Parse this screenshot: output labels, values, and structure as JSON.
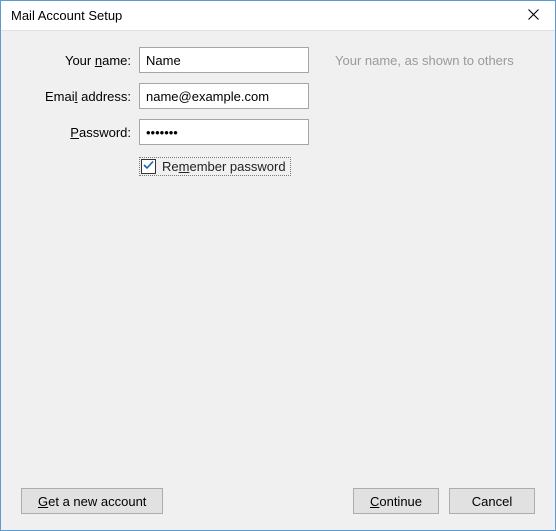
{
  "window": {
    "title": "Mail Account Setup"
  },
  "form": {
    "name_label_pre": "Your ",
    "name_label_ul": "n",
    "name_label_post": "ame:",
    "name_value": "Name",
    "name_hint": "Your name, as shown to others",
    "email_label_pre": "Emai",
    "email_label_ul": "l",
    "email_label_post": " address:",
    "email_value": "name@example.com",
    "password_label_ul": "P",
    "password_label_post": "assword:",
    "password_value": "•••••••",
    "remember_checked": true,
    "remember_pre": "Re",
    "remember_ul": "m",
    "remember_post": "ember password"
  },
  "buttons": {
    "new_account_ul": "G",
    "new_account_post": "et a new account",
    "continue_ul": "C",
    "continue_post": "ontinue",
    "cancel": "Cancel"
  }
}
